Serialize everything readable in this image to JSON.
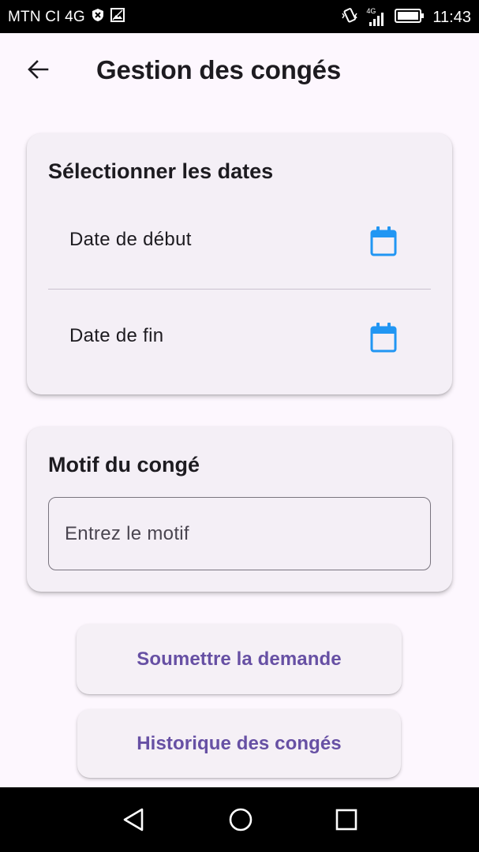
{
  "status_bar": {
    "carrier": "MTN CI 4G",
    "network_type": "4G",
    "time": "11:43"
  },
  "header": {
    "title": "Gestion des congés",
    "back_icon": "arrow-left-icon"
  },
  "dates_card": {
    "title": "Sélectionner les dates",
    "start_label": "Date de début",
    "end_label": "Date de fin",
    "icon": "calendar-icon"
  },
  "motif_card": {
    "title": "Motif du congé",
    "input_placeholder": "Entrez le motif",
    "input_value": ""
  },
  "actions": {
    "submit_label": "Soumettre la demande",
    "history_label": "Historique des congés"
  },
  "colors": {
    "accent": "#6750a4",
    "calendar_icon": "#2196f3",
    "background": "#fdf7fe",
    "card": "#f4eff6"
  }
}
